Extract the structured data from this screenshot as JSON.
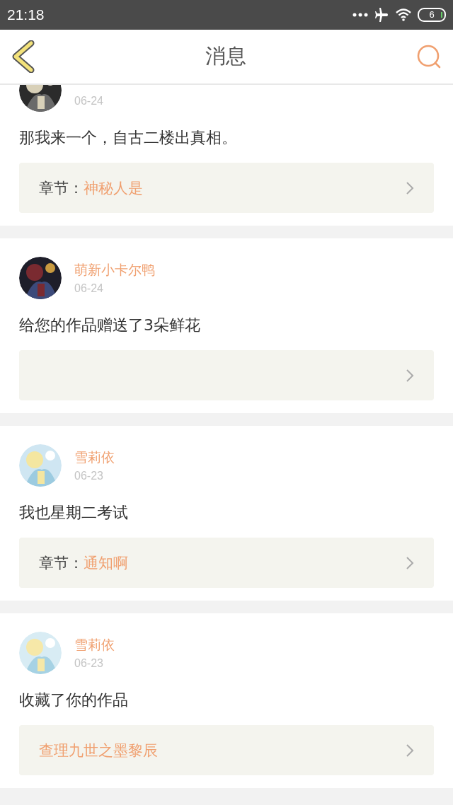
{
  "status_bar": {
    "time": "21:18",
    "battery": "6"
  },
  "header": {
    "title": "消息"
  },
  "messages": [
    {
      "date": "06-24",
      "text": "那我来一个，自古二楼出真相。",
      "link": {
        "kind": "chapter",
        "label": "章节：",
        "value": "神秘人是"
      }
    },
    {
      "name": "萌新小卡尔鸭",
      "date": "06-24",
      "text": "给您的作品赠送了3朵鲜花",
      "link": {
        "kind": "empty"
      }
    },
    {
      "name": "雪莉依",
      "date": "06-23",
      "text": "我也星期二考试",
      "link": {
        "kind": "chapter",
        "label": "章节：",
        "value": "通知啊"
      }
    },
    {
      "name": "雪莉依",
      "date": "06-23",
      "text": "收藏了你的作品",
      "link": {
        "kind": "work",
        "value": "查理九世之墨黎辰"
      }
    }
  ]
}
